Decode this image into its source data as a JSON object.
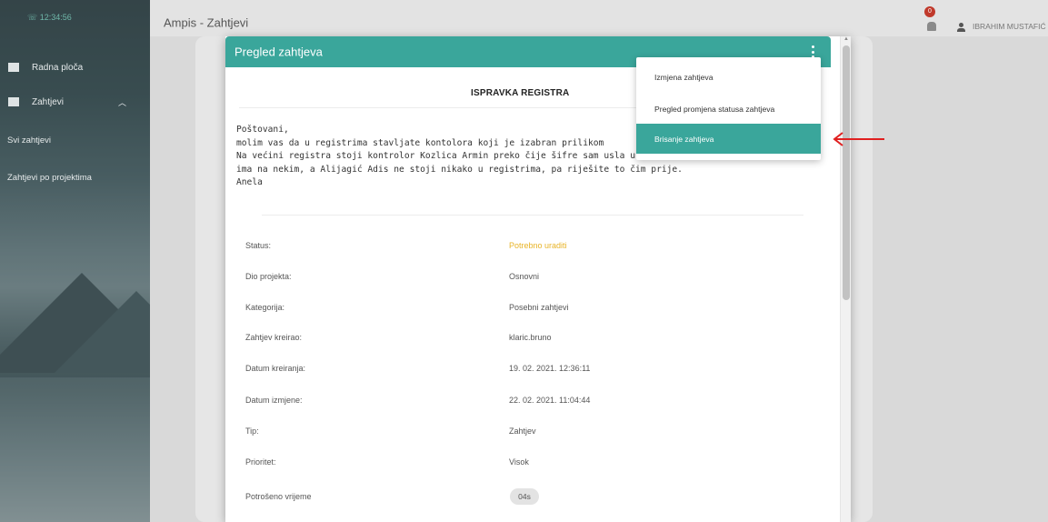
{
  "sidebar": {
    "time": "12:34:56",
    "items": [
      {
        "label": "Radna ploča",
        "icon": "dashboard-icon"
      },
      {
        "label": "Zahtjevi",
        "icon": "requests-icon"
      }
    ],
    "subitems": [
      {
        "label": "Svi zahtjevi"
      },
      {
        "label": "Zahtjevi po projektima"
      }
    ]
  },
  "header": {
    "app_title": "Ampis - Zahtjevi",
    "notification_count": "0",
    "user_name": "IBRAHIM MUSTAFIĆ"
  },
  "modal": {
    "title": "Pregled zahtjeva",
    "doc_heading": "ISPRAVKA REGISTRA",
    "message": "Poštovani,\nmolim vas da u registrima stavljate kontolora koji je izabran prilikom\nNa većini registra stoji kontrolor Kozlica Armin preko čije šifre sam usla u A-test, a Hodzić Hamza\nima na nekim, a Alijagić Adis ne stoji nikako u registrima, pa riješite to čim prije.\nAnela",
    "details": [
      {
        "label": "Status:",
        "value": "Potrebno uraditi"
      },
      {
        "label": "Dio projekta:",
        "value": "Osnovni"
      },
      {
        "label": "Kategorija:",
        "value": "Posebni zahtjevi"
      },
      {
        "label": "Zahtjev kreirao:",
        "value": "klaric.bruno"
      },
      {
        "label": "Datum kreiranja:",
        "value": "19. 02. 2021. 12:36:11"
      },
      {
        "label": "Datum izmjene:",
        "value": "22. 02. 2021. 11:04:44"
      },
      {
        "label": "Tip:",
        "value": "Zahtjev"
      },
      {
        "label": "Prioritet:",
        "value": "Visok"
      },
      {
        "label": "Potrošeno vrijeme",
        "value": "04s"
      }
    ]
  },
  "menu": {
    "items": [
      {
        "label": "Izmjena zahtjeva"
      },
      {
        "label": "Pregled promjena statusa zahtjeva"
      },
      {
        "label": "Brisanje zahtjeva",
        "active": true
      }
    ]
  },
  "colors": {
    "accent": "#3aa69b",
    "status_warning": "#e8b428",
    "annotation_arrow": "#e02020"
  }
}
